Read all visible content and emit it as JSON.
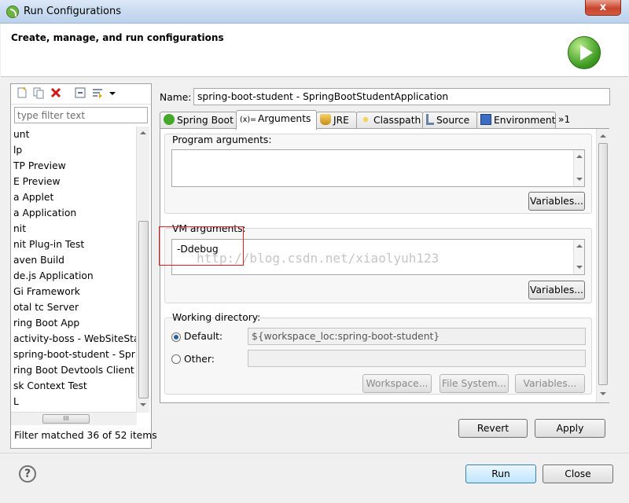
{
  "window": {
    "title": "Run Configurations",
    "close_glyph": "x"
  },
  "banner": {
    "title": "Create, manage, and run configurations",
    "icon": "run-icon"
  },
  "left": {
    "filter_placeholder": "type filter text",
    "items": [
      "unt",
      "lp",
      "TP Preview",
      "E Preview",
      "a Applet",
      "a Application",
      "nit",
      "nit Plug-in Test",
      "aven Build",
      "de.js Application",
      "Gi Framework",
      "otal tc Server",
      "ring Boot App",
      "activity-boss - WebSiteSta",
      "spring-boot-student - Spr",
      "ring Boot Devtools Client",
      "sk Context Test",
      "L"
    ],
    "hscroll_thumb": "III",
    "status": "Filter matched 36 of 52 items"
  },
  "config": {
    "name_label": "Name:",
    "name_value": "spring-boot-student - SpringBootStudentApplication",
    "tabs": [
      {
        "label": "Spring Boot",
        "icon": "spring-boot-icon"
      },
      {
        "label": "Arguments",
        "icon": "arguments-icon",
        "prefix": "(x)="
      },
      {
        "label": "JRE",
        "icon": "jre-icon"
      },
      {
        "label": "Classpath",
        "icon": "classpath-icon"
      },
      {
        "label": "Source",
        "icon": "source-icon"
      },
      {
        "label": "Environment",
        "icon": "environment-icon"
      }
    ],
    "more_tabs": "»1",
    "program_args_label": "Program arguments:",
    "variables_label": "Variables...",
    "vm_args_label": "VM arguments:",
    "vm_args_value": "-Ddebug",
    "working_dir_label": "Working directory:",
    "default_label": "Default:",
    "default_value": "${workspace_loc:spring-boot-student}",
    "other_label": "Other:",
    "workspace_btn": "Workspace...",
    "filesystem_btn": "File System...",
    "variables_btn2": "Variables..."
  },
  "watermark": "http://blog.csdn.net/xiaolyuh123",
  "buttons": {
    "revert": "Revert",
    "apply": "Apply",
    "run": "Run",
    "close": "Close",
    "help": "?"
  }
}
